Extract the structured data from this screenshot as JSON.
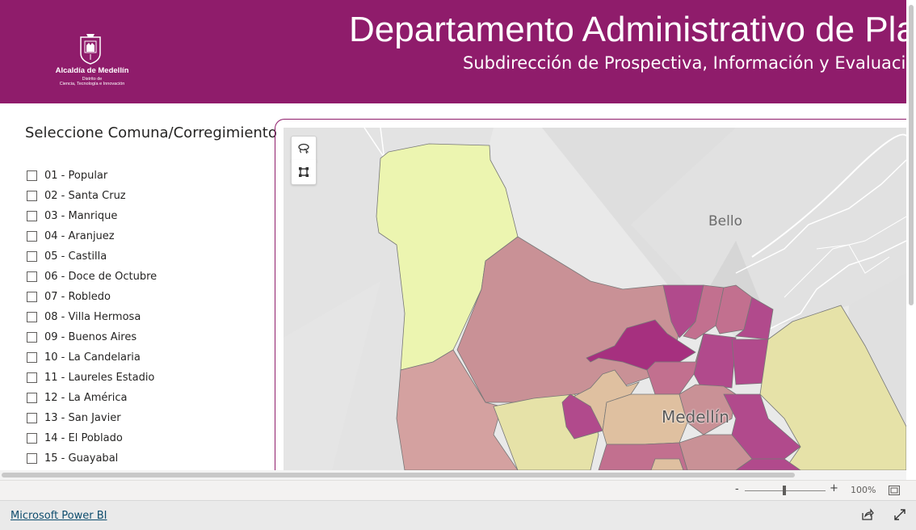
{
  "header": {
    "logo": {
      "name": "Alcaldía de Medellín",
      "subtitle_line1": "Distrito de",
      "subtitle_line2": "Ciencia, Tecnología e Innovación"
    },
    "title": "Departamento Administrativo de Plan",
    "subtitle": "Subdirección de Prospectiva, Información y Evaluació",
    "background_color": "#8f1c6b"
  },
  "slicer": {
    "title": "Seleccione Comuna/Corregimiento",
    "items": [
      {
        "label": "01 - Popular",
        "checked": false
      },
      {
        "label": "02 - Santa Cruz",
        "checked": false
      },
      {
        "label": "03 - Manrique",
        "checked": false
      },
      {
        "label": "04 - Aranjuez",
        "checked": false
      },
      {
        "label": "05 - Castilla",
        "checked": false
      },
      {
        "label": "06 - Doce de Octubre",
        "checked": false
      },
      {
        "label": "07 - Robledo",
        "checked": false
      },
      {
        "label": "08 - Villa Hermosa",
        "checked": false
      },
      {
        "label": "09 - Buenos Aires",
        "checked": false
      },
      {
        "label": "10 - La Candelaria",
        "checked": false
      },
      {
        "label": "11 - Laureles Estadio",
        "checked": false
      },
      {
        "label": "12 - La América",
        "checked": false
      },
      {
        "label": "13 - San Javier",
        "checked": false
      },
      {
        "label": "14 - El Poblado",
        "checked": false
      },
      {
        "label": "15 - Guayabal",
        "checked": false
      }
    ]
  },
  "map": {
    "labels": {
      "bello": "Bello",
      "medellin": "Medellín"
    },
    "tools": [
      "lasso-select-icon",
      "rectangle-select-icon"
    ],
    "fill_colors": [
      "#ecf5b0",
      "#e6e2a8",
      "#dfc0a0",
      "#d4a1a0",
      "#c99196",
      "#c2708f",
      "#b14a8c",
      "#a6307f"
    ]
  },
  "zoom": {
    "minus": "-",
    "plus": "+",
    "level": "100%"
  },
  "footer": {
    "link": "Microsoft Power BI"
  }
}
